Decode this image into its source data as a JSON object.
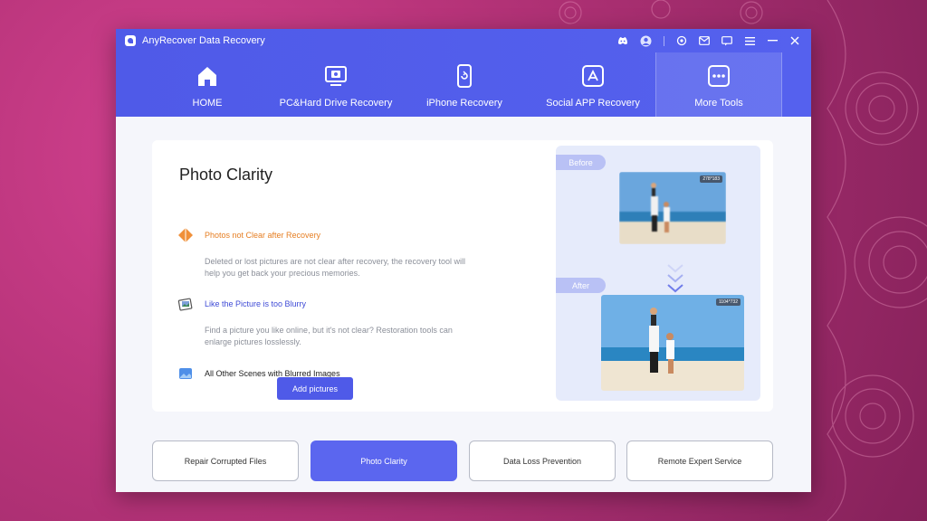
{
  "window": {
    "title": "AnyRecover Data Recovery"
  },
  "titlebar_icons": [
    "discord-icon",
    "avatar-icon",
    "settings-icon",
    "mail-icon",
    "chat-icon",
    "menu-icon",
    "minimize-icon",
    "close-icon"
  ],
  "nav": {
    "items": [
      {
        "label": "HOME",
        "icon": "home-icon"
      },
      {
        "label": "PC&Hard Drive Recovery",
        "icon": "hard-drive-icon"
      },
      {
        "label": "iPhone Recovery",
        "icon": "iphone-icon"
      },
      {
        "label": "Social APP Recovery",
        "icon": "app-store-icon"
      },
      {
        "label": "More Tools",
        "icon": "more-icon",
        "active": true
      }
    ]
  },
  "feature": {
    "title": "Photo Clarity",
    "points": [
      {
        "heading": "Photos not Clear after Recovery",
        "color": "#e67e22",
        "description": "Deleted or lost pictures are not clear after recovery, the recovery tool will help you get back your precious memories."
      },
      {
        "heading": "Like the Picture is too Blurry",
        "color": "#3f4bd6",
        "description": "Find a picture you like online, but it's not clear? Restoration tools can enlarge pictures losslessly."
      },
      {
        "heading": "All Other Scenes with Blurred Images",
        "color": "#222222",
        "description": ""
      }
    ],
    "add_button": "Add pictures"
  },
  "compare": {
    "before_label": "Before",
    "after_label": "After",
    "before_size": "278*183",
    "after_size": "1104*732"
  },
  "bottom_tabs": [
    {
      "label": "Repair Corrupted Files"
    },
    {
      "label": "Photo Clarity",
      "active": true
    },
    {
      "label": "Data Loss Prevention"
    },
    {
      "label": "Remote Expert Service"
    }
  ],
  "colors": {
    "accent": "#4f5ae8",
    "background": "#b8347a"
  }
}
